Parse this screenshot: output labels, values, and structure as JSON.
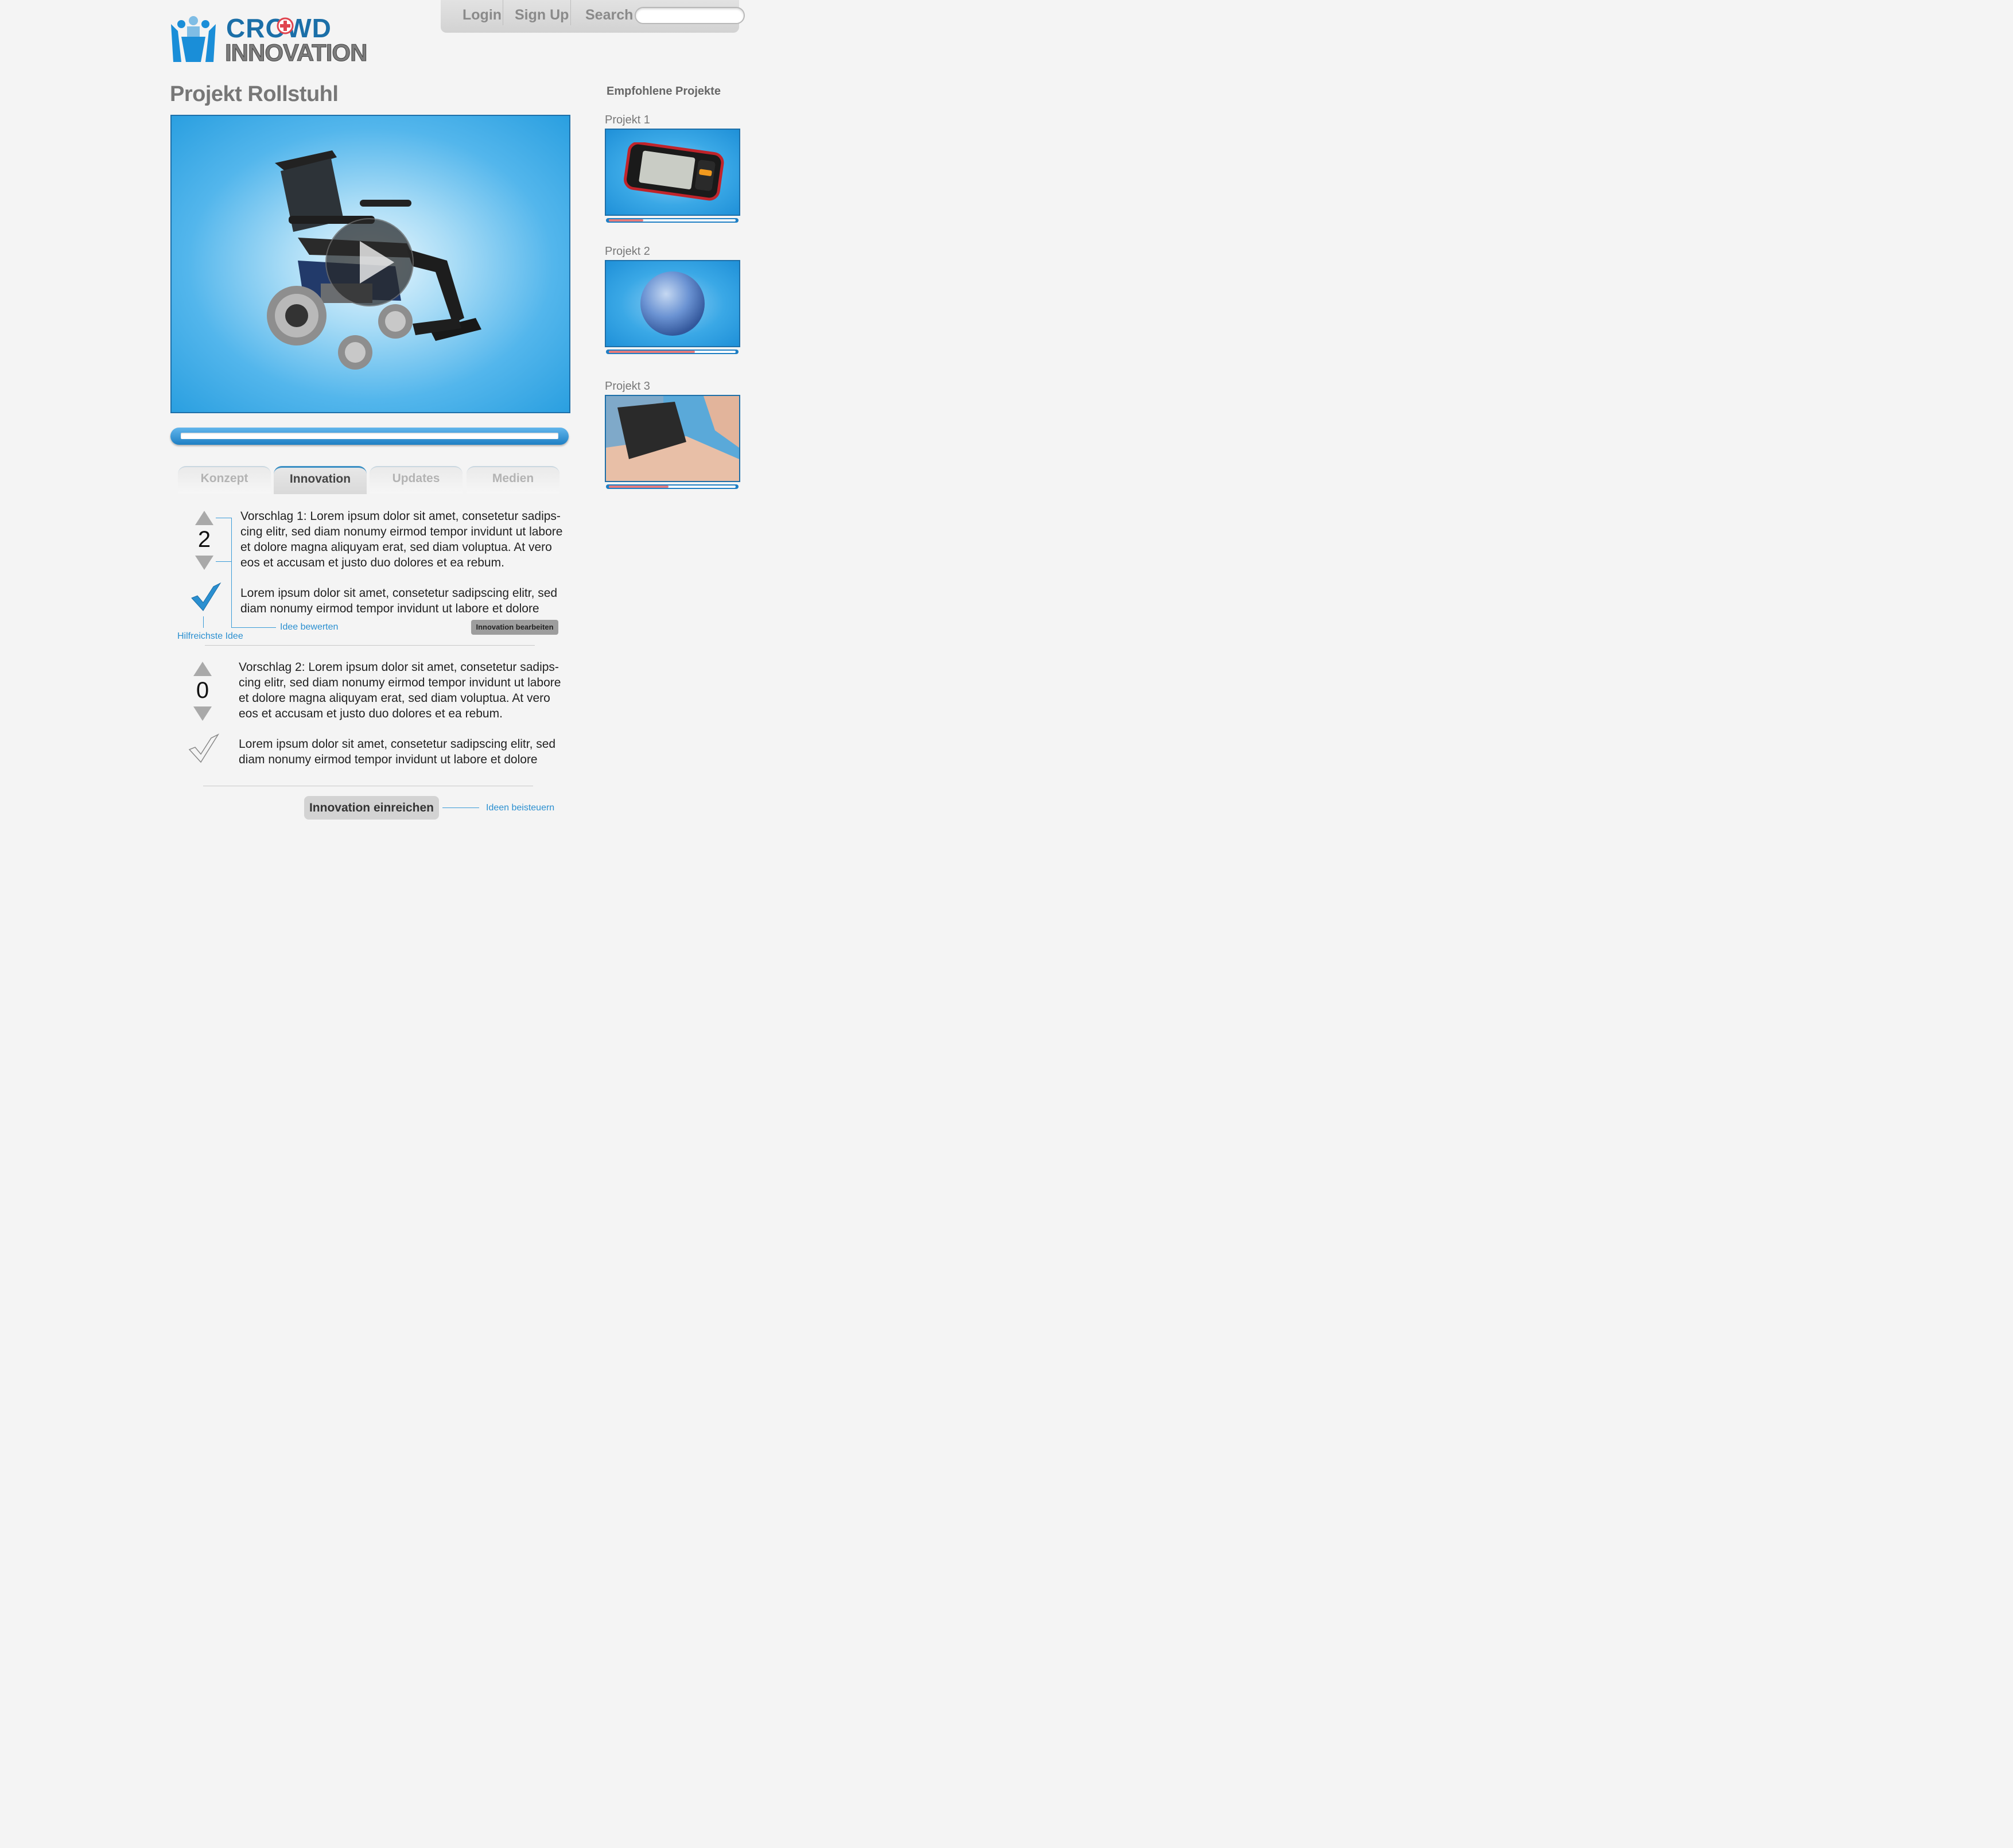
{
  "header": {
    "logo_top": "CROWD",
    "logo_bottom": "INNOVATION",
    "nav": {
      "login": "Login",
      "signup": "Sign Up",
      "search": "Search"
    },
    "search_placeholder": ""
  },
  "project": {
    "title": "Projekt Rollstuhl",
    "video_progress": 0.0
  },
  "tabs": [
    {
      "label": "Konzept",
      "active": false
    },
    {
      "label": "Innovation",
      "active": true
    },
    {
      "label": "Updates",
      "active": false
    },
    {
      "label": "Medien",
      "active": false
    }
  ],
  "proposals": [
    {
      "votes": "2",
      "text1": "Vorschlag 1: Lorem ipsum dolor sit amet, consetetur sadips-cing elitr, sed diam nonumy eirmod tempor invidunt ut labore et dolore magna aliquyam erat, sed diam voluptua. At vero eos et accusam et justo duo dolores et ea rebum.",
      "text2": "Lorem ipsum dolor sit amet, consetetur sadipscing elitr, sed diam nonumy eirmod tempor invidunt ut labore et dolore",
      "marked_helpful": true
    },
    {
      "votes": "0",
      "text1": "Vorschlag 2: Lorem ipsum dolor sit amet, consetetur sadips-cing elitr, sed diam nonumy eirmod tempor invidunt ut labore et dolore magna aliquyam erat, sed diam voluptua. At vero eos et accusam et justo duo dolores et ea rebum.",
      "text2": "Lorem ipsum dolor sit amet, consetetur sadipscing elitr, sed diam nonumy eirmod tempor invidunt ut labore et dolore",
      "marked_helpful": false
    }
  ],
  "annotations": {
    "helpful": "Hilfreichste Idee",
    "rate": "Idee bewerten",
    "contribute": "Ideen beisteuern"
  },
  "buttons": {
    "edit": "Innovation bearbeiten",
    "submit": "Innovation einreichen"
  },
  "sidebar": {
    "title": "Empfohlene Projekte",
    "projects": [
      {
        "label": "Projekt 1",
        "progress": 0.27
      },
      {
        "label": "Projekt 2",
        "progress": 0.68
      },
      {
        "label": "Projekt 3",
        "progress": 0.47
      }
    ]
  },
  "colors": {
    "accent": "#2a8fd0",
    "brand_blue": "#1b6fa8",
    "progress_red": "#e77a7a"
  }
}
